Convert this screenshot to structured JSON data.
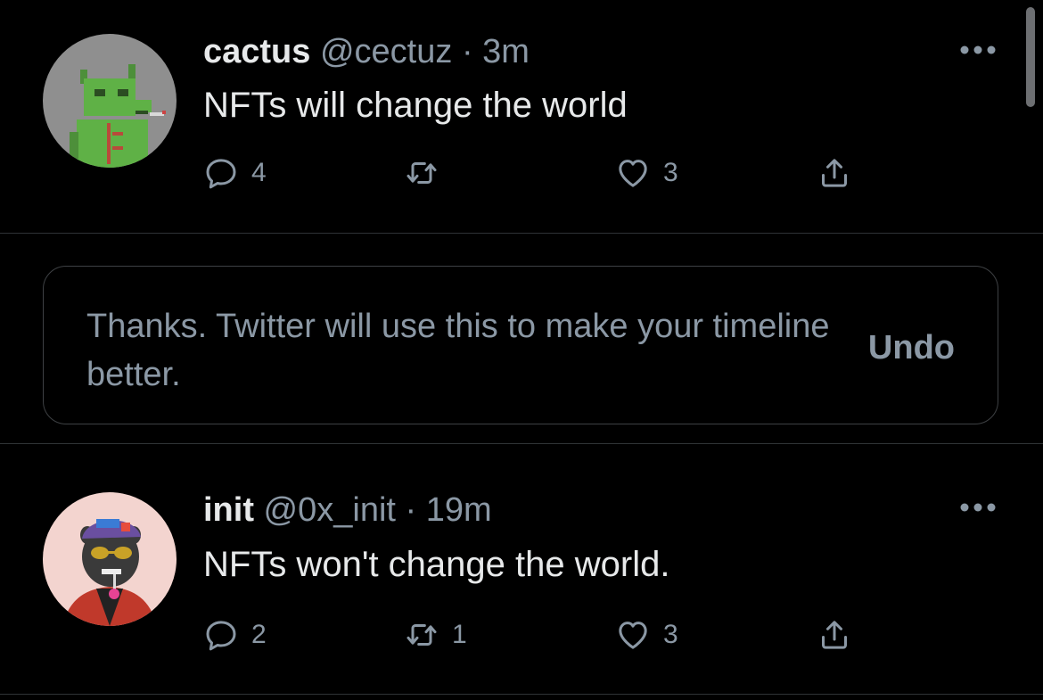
{
  "tweets": [
    {
      "name": "cactus",
      "handle": "@cectuz",
      "dot": "·",
      "time": "3m",
      "text": "NFTs will change the world",
      "replies": "4",
      "retweets": "",
      "likes": "3",
      "avatar_icon": "pixel-cactus-cat-avatar"
    },
    {
      "name": "init",
      "handle": "@0x_init",
      "dot": "·",
      "time": "19m",
      "text": "NFTs won't change the world.",
      "replies": "2",
      "retweets": "1",
      "likes": "3",
      "avatar_icon": "panther-avatar"
    }
  ],
  "notice": {
    "text": "Thanks. Twitter will use this to make your timeline better.",
    "undo_label": "Undo"
  },
  "icons": {
    "reply": "reply-icon",
    "retweet": "retweet-icon",
    "like": "heart-icon",
    "share": "share-icon",
    "more": "more-icon"
  },
  "colors": {
    "background": "#000000",
    "text_primary": "#e7e9ea",
    "text_secondary": "#8b98a5",
    "border": "#2f3336"
  }
}
